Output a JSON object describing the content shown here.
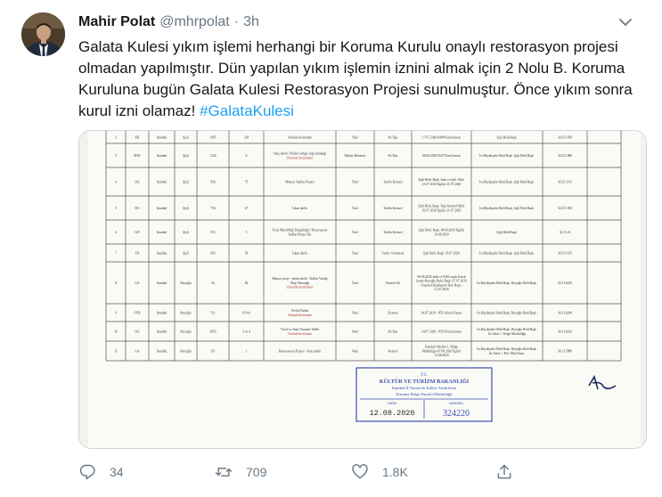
{
  "tweet": {
    "author_name": "Mahir Polat",
    "author_handle": "@mhrpolat",
    "separator": "·",
    "time": "3h",
    "text_main": "Galata Kulesi yıkım işlemi herhangi bir Koruma Kurulu onaylı restorasyon projesi olmadan yapılmıştır. Dün yapılan yıkım işlemin iznini almak için 2 Nolu B. Koruma Kuruluna bugün Galata Kulesi Restorasyon Projesi sunulmuştur. Önce yıkım sonra kurul izni olamaz!",
    "hashtag": "#GalataKulesi",
    "stats": {
      "replies": "34",
      "retweets": "709",
      "likes": "1.8K"
    }
  },
  "document": {
    "rows": [
      {
        "no": "2",
        "code": "EK",
        "il": "İstanbul",
        "ilce": "Şişli",
        "ada": "1905",
        "parsel": "218",
        "desc": "Yerinde İncelenme",
        "mulk": "Özel",
        "tescil": "Sit Dışı",
        "karar": "17.07.2020-8498 Kurul kararı",
        "kurum": "Şişli Beld.Başk.",
        "num": "34.35.1450"
      },
      {
        "no": "3",
        "code": "MAT",
        "il": "İstanbul",
        "ilce": "Şişli",
        "ada": "1324",
        "parsel": "8",
        "desc": "Satış talebi / Kültür varlığı olup olmadığı",
        "desc2": "(Yerinde İncelenme)",
        "mulk": "Maliye Hazinesi",
        "tescil": "Sit Dışı",
        "karar": "06.08.2020-8547 Kurul kararı",
        "kurum": "İst.Büyükşehir Beld.Başk. Şişli Beld.Başk.",
        "num": "34.35.1980"
      },
      {
        "no": "4",
        "code": "DA",
        "il": "İstanbul",
        "ilce": "Şişli",
        "ada": "936",
        "parsel": "75",
        "desc": "Mimari Tadilat Projesi",
        "mulk": "Özel",
        "tescil": "Tarihi+Kentsel",
        "karar": "Şişli Beld. Başk. İmar ve Şeh. Müd. 21.07.2020 İlgilisi 21.07.2020",
        "kurum": "İst.Büyükşehir Beld.Başk. Şişli Beld.Başk.",
        "num": "34.35.1141"
      },
      {
        "no": "5",
        "code": "DA",
        "il": "İstanbul",
        "ilce": "Şişli",
        "ada": "756",
        "parsel": "47",
        "desc": "İskan talebi",
        "mulk": "Özel",
        "tescil": "Tarihi+Kentsel",
        "karar": "Şişli Beld. Başk. Yapı Kontrol Müd. 02.07.2020 İlgilisi 21.07.2020",
        "kurum": "İst.Büyükşehir Beld.Başk. Şişli Beld.Başk.",
        "num": "34.35.1393"
      },
      {
        "no": "6",
        "code": "GD",
        "il": "İstanbul",
        "ilce": "Şişli",
        "ada": "815",
        "parsel": "5",
        "desc": "Proje Müellifliği Değişikliği / Restorasyon Tadilat Projesi İlk.",
        "mulk": "Özel",
        "tescil": "Tarihi+Kentsel",
        "karar": "Şişli Beld. Başk. 04.03.2020 İlgilisi 10.08.2020",
        "kurum": "Şişli Beld.Başk.",
        "num": "34.13.43"
      },
      {
        "no": "7",
        "code": "DI",
        "il": "İstanbul",
        "ilce": "Şişli",
        "ada": "665",
        "parsel": "38",
        "desc": "İskan talebi",
        "mulk": "Özel",
        "tescil": "Tarihi ve Kentsel",
        "karar": "Şişli Beld. Başk. 03.07.2020",
        "kurum": "İst.Büyükşehir Beld.Başk. Şişli Beld.Başk.",
        "num": "34.35.1615"
      },
      {
        "no": "8",
        "code": "GA",
        "il": "İstanbul",
        "ilce": "Beyoğlu",
        "ada": "94",
        "parsel": "82",
        "desc": "Mimari proje - yıkım talebi - Kültür Varlığı Olup Olmadığı",
        "desc2": "(Yerinde İncelenme)",
        "mulk": "Özel",
        "tescil": "Kentsel Sit",
        "karar": "06.06.2020 tarih ve 8383 sayılı Kurul kararı-Beyoğlu Beld. Başk. 07.07.2020 - İstanbul Büyükşehir Bel. Başk. - 21.07.2020",
        "kurum": "İst.Büyükşehir Beld.Başk. Beyoğlu Beld.Başk.",
        "num": "34.13.6233"
      },
      {
        "no": "9",
        "code": "SYB",
        "il": "İstanbul",
        "ilce": "Beyoğlu",
        "ada": "511",
        "parsel": "63-64",
        "desc": "Tevhid Talebi",
        "desc2": "Yerinde İncelenme",
        "mulk": "Özel",
        "tescil": "Kentsel",
        "karar": "24.07.2020 - 8531 Kurul Kararı",
        "kurum": "İst.Büyükşehir Beld.Başk. Beyoğlu Beld.Başk.",
        "num": "34.13.6240"
      },
      {
        "no": "10",
        "code": "OG",
        "il": "İstanbul",
        "ilce": "Beyoğlu",
        "ada": "2953",
        "parsel": "3 ve 4",
        "desc": "Tescil ve İmar Durumu Talebi",
        "desc2": "Yerinde İncelenme",
        "mulk": "Vakıf",
        "tescil": "Sit Dışı",
        "karar": "24.07.2020 - 8519 Kurul kararı",
        "kurum": "İst.Büyükşehir Beld.Başk. Beyoğlu Beld.Başk. İst.Vakıf 1. Bölge Müdürlüğü",
        "num": "34.13.6242"
      },
      {
        "no": "11",
        "code": "GA",
        "il": "İstanbul",
        "ilce": "Beyoğlu",
        "ada": "151",
        "parsel": "1",
        "desc": "Restorasyon Projesi - Kazı talebi",
        "mulk": "Vakıf",
        "tescil": "Kentsel",
        "karar": "İstanbul Vakıflar 1. Bölge Müdürlüğü-07.08.2020 İlgilisi 12.08.2020",
        "kurum": "İst.Büyükşehir Beld.Başk. Beyoğlu Beld.Başk. İst.Vakıf 1. Böl. Müd.Tems.",
        "num": "34.13.5889"
      }
    ],
    "stamp": {
      "line1": "T.C.",
      "line2": "KÜLTÜR VE TURİZM BAKANLIĞI",
      "line3": "İstanbul II Numaralı Kültür Varlıklarını",
      "line4": "Koruma Bölge Kurulu Müdürlüğü",
      "label_date": "TARİH",
      "label_no": "NUMARA",
      "date": "12.08.2020",
      "number": "324220"
    }
  }
}
